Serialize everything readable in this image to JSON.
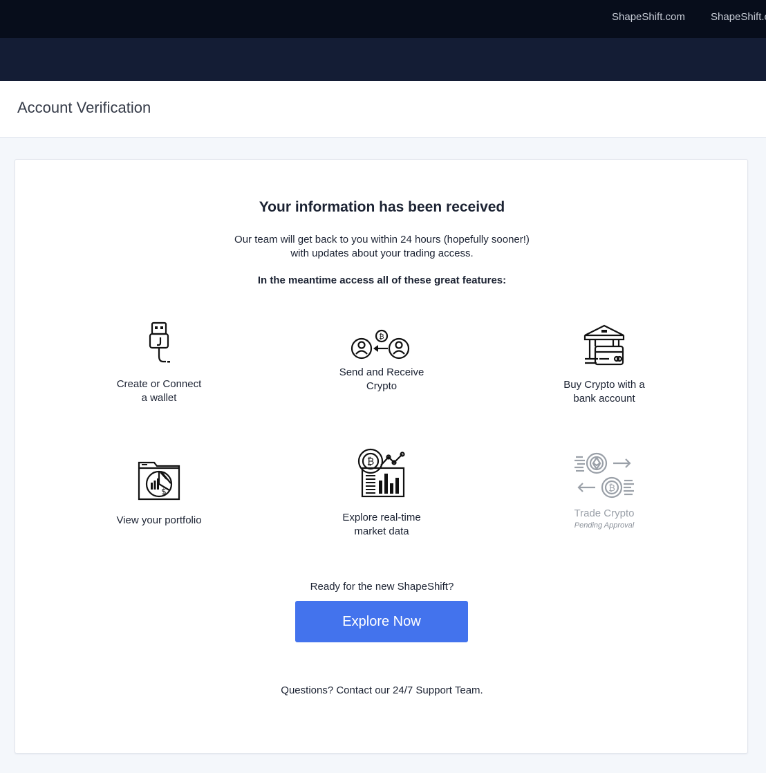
{
  "topbar": {
    "links": [
      "ShapeShift.com",
      "ShapeShift.com"
    ]
  },
  "page": {
    "title": "Account Verification"
  },
  "card": {
    "title": "Your information has been received",
    "subtitle_line1": "Our team will get back to you within 24 hours (hopefully sooner!)",
    "subtitle_line2": "with updates about your trading access.",
    "meantime": "In the meantime access all of these great features:",
    "features": [
      {
        "line1": "Create or Connect",
        "line2": "a wallet",
        "icon": "usb-wallet-icon"
      },
      {
        "line1": "Send and Receive",
        "line2": "Crypto",
        "icon": "send-receive-icon"
      },
      {
        "line1": "Buy Crypto with a",
        "line2": "bank account",
        "icon": "bank-card-icon"
      },
      {
        "line1": "View your portfolio",
        "line2": "",
        "icon": "portfolio-icon"
      },
      {
        "line1": "Explore real-time",
        "line2": "market data",
        "icon": "market-data-icon"
      },
      {
        "line1": "Trade Crypto",
        "line2": "",
        "status": "Pending Approval",
        "icon": "trade-crypto-icon"
      }
    ],
    "ready_text": "Ready for the new ShapeShift?",
    "explore_button": "Explore Now",
    "questions_text": "Questions? Contact our 24/7 Support Team."
  },
  "colors": {
    "topbar": "#070d1b",
    "navbar": "#141d35",
    "primary_button": "#4373ed",
    "disabled_text": "#9aa0a8"
  }
}
